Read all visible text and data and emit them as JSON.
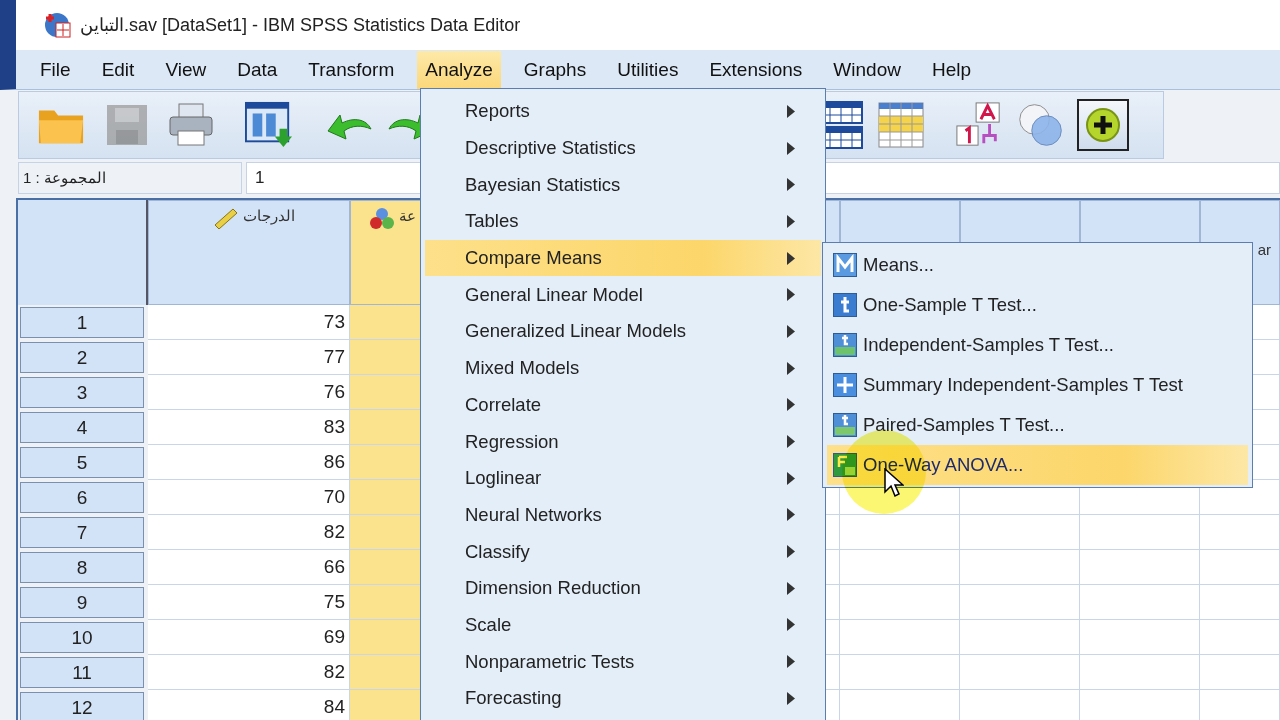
{
  "window": {
    "title": "التباين.sav [DataSet1] - IBM SPSS Statistics Data Editor"
  },
  "menu_bar": [
    {
      "label": "File",
      "selected": false
    },
    {
      "label": "Edit",
      "selected": false
    },
    {
      "label": "View",
      "selected": false
    },
    {
      "label": "Data",
      "selected": false
    },
    {
      "label": "Transform",
      "selected": false
    },
    {
      "label": "Analyze",
      "selected": true
    },
    {
      "label": "Graphs",
      "selected": false
    },
    {
      "label": "Utilities",
      "selected": false
    },
    {
      "label": "Extensions",
      "selected": false
    },
    {
      "label": "Window",
      "selected": false
    },
    {
      "label": "Help",
      "selected": false
    }
  ],
  "toolbar": [
    {
      "kind": "open",
      "disabled": false,
      "pressed": false
    },
    {
      "kind": "save",
      "disabled": true,
      "pressed": false
    },
    {
      "kind": "print",
      "disabled": false,
      "pressed": false
    },
    {
      "kind": "recall",
      "disabled": false,
      "pressed": false
    },
    {
      "kind": "undo",
      "disabled": false,
      "pressed": false
    },
    {
      "kind": "redo",
      "disabled": false,
      "pressed": false
    },
    {
      "kind": "variables",
      "disabled": false,
      "pressed": false
    },
    {
      "kind": "select_cases",
      "disabled": false,
      "pressed": false
    },
    {
      "kind": "value_labels",
      "disabled": false,
      "pressed": false
    },
    {
      "kind": "sets",
      "disabled": false,
      "pressed": false
    },
    {
      "kind": "show_all",
      "disabled": false,
      "pressed": true
    }
  ],
  "cell_editor": {
    "cell": "المجموعة : 1",
    "value": "1"
  },
  "grid": {
    "columns": [
      {
        "header": "الدرجات",
        "kind": "scale",
        "selected": false
      },
      {
        "header": "عة",
        "kind": "nominal",
        "selected": true
      },
      {
        "kind": "blank",
        "selected": false
      },
      {
        "kind": "blank",
        "selected": false
      },
      {
        "kind": "blank",
        "selected": false
      },
      {
        "header": "ar",
        "kind": "blank",
        "selected": false
      }
    ],
    "rows": [
      {
        "number": "1",
        "values": [
          "73"
        ]
      },
      {
        "number": "2",
        "values": [
          "77"
        ]
      },
      {
        "number": "3",
        "values": [
          "76"
        ]
      },
      {
        "number": "4",
        "values": [
          "83"
        ]
      },
      {
        "number": "5",
        "values": [
          "86"
        ]
      },
      {
        "number": "6",
        "values": [
          "70"
        ]
      },
      {
        "number": "7",
        "values": [
          "82"
        ]
      },
      {
        "number": "8",
        "values": [
          "66"
        ]
      },
      {
        "number": "9",
        "values": [
          "75"
        ]
      },
      {
        "number": "10",
        "values": [
          "69"
        ]
      },
      {
        "number": "11",
        "values": [
          "82"
        ]
      },
      {
        "number": "12",
        "values": [
          "84"
        ]
      }
    ]
  },
  "analyze_menu": {
    "items": [
      {
        "label": "Reports",
        "selected": false,
        "has_submenu": true
      },
      {
        "label": "Descriptive Statistics",
        "selected": false,
        "has_submenu": true
      },
      {
        "label": "Bayesian Statistics",
        "selected": false,
        "has_submenu": true
      },
      {
        "label": "Tables",
        "selected": false,
        "has_submenu": true
      },
      {
        "label": "Compare Means",
        "selected": true,
        "has_submenu": true
      },
      {
        "label": "General Linear Model",
        "selected": false,
        "has_submenu": true
      },
      {
        "label": "Generalized Linear Models",
        "selected": false,
        "has_submenu": true
      },
      {
        "label": "Mixed Models",
        "selected": false,
        "has_submenu": true
      },
      {
        "label": "Correlate",
        "selected": false,
        "has_submenu": true
      },
      {
        "label": "Regression",
        "selected": false,
        "has_submenu": true
      },
      {
        "label": "Loglinear",
        "selected": false,
        "has_submenu": true
      },
      {
        "label": "Neural Networks",
        "selected": false,
        "has_submenu": true
      },
      {
        "label": "Classify",
        "selected": false,
        "has_submenu": true
      },
      {
        "label": "Dimension Reduction",
        "selected": false,
        "has_submenu": true
      },
      {
        "label": "Scale",
        "selected": false,
        "has_submenu": true
      },
      {
        "label": "Nonparametric Tests",
        "selected": false,
        "has_submenu": true
      },
      {
        "label": "Forecasting",
        "selected": false,
        "has_submenu": true
      }
    ]
  },
  "compare_means_menu": {
    "items": [
      {
        "label": "Means...",
        "kind": "means",
        "selected": false
      },
      {
        "label": "One-Sample T Test...",
        "kind": "t",
        "selected": false
      },
      {
        "label": "Independent-Samples T Test...",
        "kind": "t_independent",
        "selected": false
      },
      {
        "label": "Summary Independent-Samples T Test",
        "kind": "plus",
        "selected": false
      },
      {
        "label": "Paired-Samples T Test...",
        "kind": "t_paired",
        "selected": false
      },
      {
        "label": "One-Way ANOVA...",
        "kind": "anova",
        "selected": true
      }
    ]
  }
}
